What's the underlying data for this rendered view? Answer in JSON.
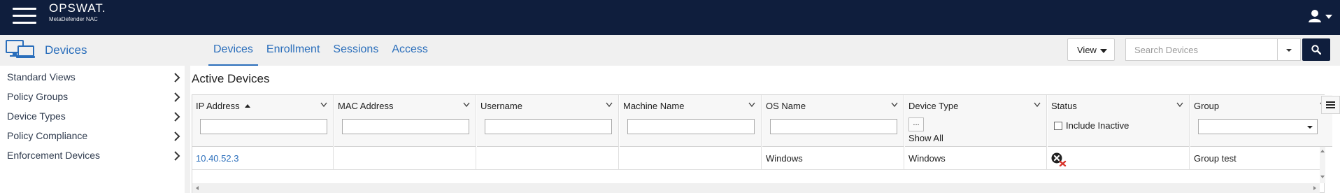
{
  "brand": {
    "name": "OPSWAT.",
    "product": "MetaDefender NAC"
  },
  "header": {
    "title": "Devices",
    "tabs": [
      {
        "label": "Devices",
        "active": true
      },
      {
        "label": "Enrollment",
        "active": false
      },
      {
        "label": "Sessions",
        "active": false
      },
      {
        "label": "Access",
        "active": false
      }
    ],
    "view_label": "View",
    "search_placeholder": "Search Devices"
  },
  "sidebar": {
    "items": [
      {
        "label": "Standard Views"
      },
      {
        "label": "Policy Groups"
      },
      {
        "label": "Device Types"
      },
      {
        "label": "Policy Compliance"
      },
      {
        "label": "Enforcement Devices"
      }
    ]
  },
  "main": {
    "title": "Active Devices",
    "columns": [
      {
        "label": "IP Address",
        "sorted": "asc"
      },
      {
        "label": "MAC Address"
      },
      {
        "label": "Username"
      },
      {
        "label": "Machine Name"
      },
      {
        "label": "OS Name"
      },
      {
        "label": "Device Type"
      },
      {
        "label": "Status"
      },
      {
        "label": "Group"
      }
    ],
    "device_type_filter": {
      "button_label": "...",
      "show_all_label": "Show All"
    },
    "status_filter": {
      "include_inactive_label": "Include Inactive",
      "checked": false
    },
    "rows": [
      {
        "ip_address": "10.40.52.3",
        "mac_address": "",
        "username": "",
        "machine_name": "",
        "os_name": "Windows",
        "device_type": "Windows",
        "status_icon": "inactive-status-icon",
        "group": "Group test"
      }
    ]
  },
  "colors": {
    "topbar": "#0f1e3d",
    "accent": "#2a6ebb",
    "status_x": "#d9342b"
  }
}
